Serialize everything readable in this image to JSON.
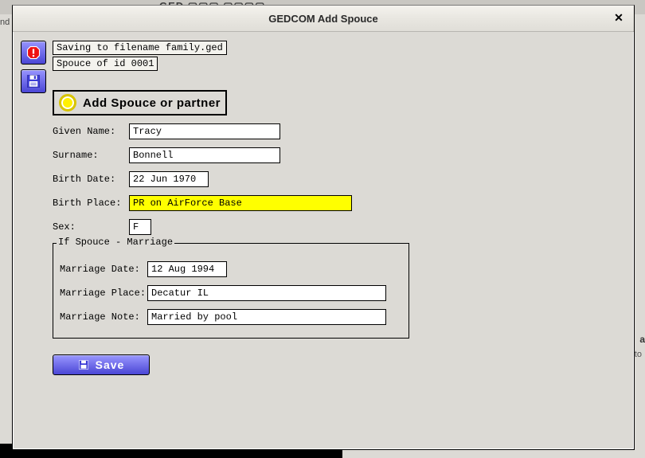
{
  "background": {
    "app_title_fragment": "GED ▢▢▢ ▢▢▢▢",
    "left_fragment": "nd",
    "right_bold": "a",
    "right_snippet": "ke it's supposed to"
  },
  "dialog": {
    "title": "GEDCOM Add Spouce",
    "status_line_1": "Saving to filename family.ged",
    "status_line_2": "Spouce of id 0001",
    "section_header": "Add Spouce or partner",
    "labels": {
      "given": "Given Name:",
      "surname": "Surname:",
      "bdate": "Birth Date:",
      "bplace": "Birth Place:",
      "sex": "Sex:"
    },
    "values": {
      "given": "Tracy",
      "surname": "Bonnell",
      "bdate": "22 Jun 1970",
      "bplace": "PR on AirForce Base",
      "sex": "F"
    },
    "marriage": {
      "legend": "If Spouce - Marriage",
      "labels": {
        "mdate": "Marriage Date:",
        "mplace": "Marriage Place:",
        "mnote": "Marriage Note:"
      },
      "values": {
        "mdate": "12 Aug 1994",
        "mplace": "Decatur IL",
        "mnote": "Married by pool"
      }
    },
    "save_label": "Save"
  }
}
